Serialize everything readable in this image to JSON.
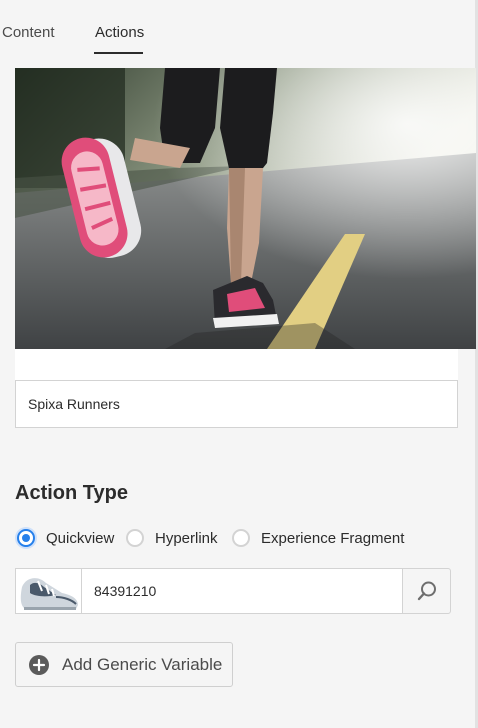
{
  "tabs": [
    {
      "label": "Content",
      "active": false
    },
    {
      "label": "Actions",
      "active": true
    }
  ],
  "hero": {
    "alt": "Runner on road wearing pink running shoes"
  },
  "title_field": {
    "value": "Spixa Runners"
  },
  "action_type": {
    "heading": "Action Type",
    "options": [
      {
        "label": "Quickview",
        "checked": true
      },
      {
        "label": "Hyperlink",
        "checked": false
      },
      {
        "label": "Experience Fragment",
        "checked": false
      }
    ]
  },
  "product": {
    "sku": "84391210",
    "thumbnail": "running-shoe-thumbnail",
    "search_icon": "search-icon"
  },
  "add_variable": {
    "label": "Add Generic Variable",
    "icon": "add-circle-icon"
  },
  "colors": {
    "accent": "#2680eb",
    "background": "#f5f5f5",
    "border": "#d3d3d3",
    "text": "#2c2c2c"
  }
}
